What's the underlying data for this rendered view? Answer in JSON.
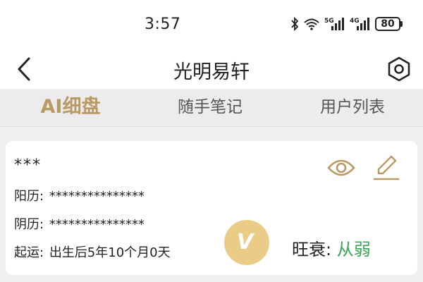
{
  "status_bar": {
    "time": "3:57",
    "battery": "80",
    "icons": [
      "bluetooth-icon",
      "wifi-icon",
      "signal-5g-icon",
      "signal-4g-icon",
      "battery-icon"
    ],
    "net_5g": "5G",
    "net_4g": "4G"
  },
  "header": {
    "title": "光明易轩",
    "back_icon": "chevron-left-icon",
    "settings_icon": "hexagon-settings-icon"
  },
  "tabs": [
    {
      "label": "AI细盘",
      "active": true
    },
    {
      "label": "随手笔记",
      "active": false
    },
    {
      "label": "用户列表",
      "active": false
    }
  ],
  "card": {
    "name": "***",
    "solar_label": "阳历:",
    "solar_value": "***************",
    "lunar_label": "阴历:",
    "lunar_value": "***************",
    "luck_label": "起运:",
    "luck_value": "出生后5年10个月0天",
    "strength_label": "旺衰:",
    "strength_value": "从弱",
    "icons": [
      "eye-icon",
      "edit-icon"
    ]
  },
  "colors": {
    "accent_gold": "#b99a62",
    "strength_green": "#3aa556",
    "tab_bg": "#ececec",
    "page_bg": "#efefef"
  }
}
